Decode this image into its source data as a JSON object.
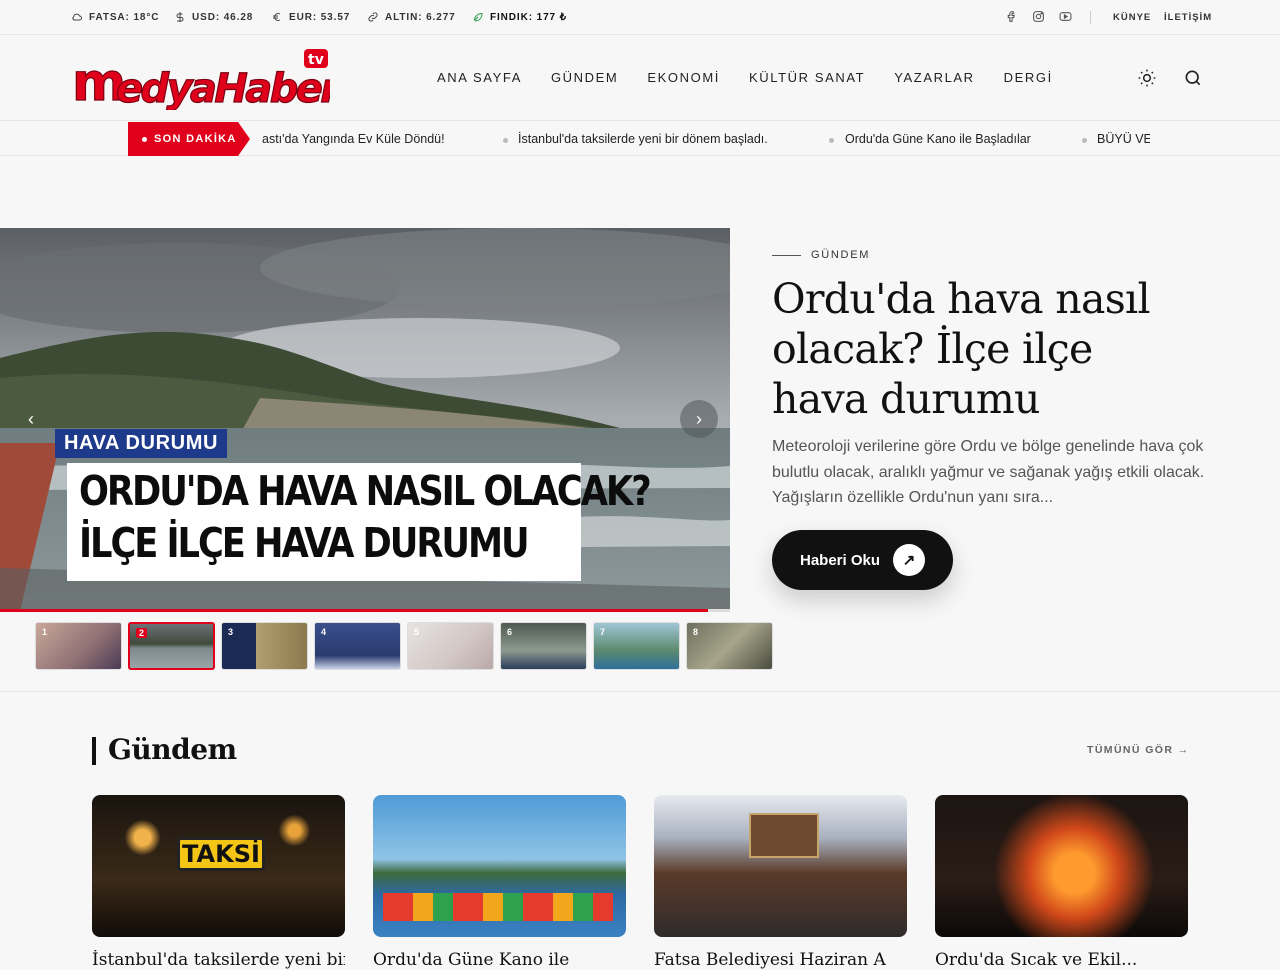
{
  "topbar": {
    "weather": "FATSA: 18°C",
    "usd": "USD: 46.28",
    "eur": "EUR: 53.57",
    "gold": "ALTIN: 6.277",
    "hazelnut": "FINDIK: 177 ₺",
    "links": [
      "KÜNYE",
      "İLETİŞİM"
    ],
    "social_icons": [
      "facebook-icon",
      "instagram-icon",
      "youtube-icon"
    ]
  },
  "header": {
    "logo_text": "medyaHaber",
    "logo_badge": "tv",
    "nav": [
      "ANA SAYFA",
      "GÜNDEM",
      "EKONOMİ",
      "KÜLTÜR SANAT",
      "YAZARLAR",
      "DERGİ"
    ]
  },
  "breaking": {
    "label": "SON DAKİKA",
    "items": [
      "Kabadüz'de Baskı: Aşırı Sıcaklar ve Korkutan Anlar – Yabastı'da Yangında Ev Küle Döndü!",
      "İstanbul'da taksilerde yeni bir dönem başladı.",
      "Ordu'da Güne Kano ile Başladılar",
      "BÜYÜ VE"
    ],
    "first_visible": "astı'da Yangında Ev Küle Döndü!"
  },
  "hero": {
    "category": "GÜNDEM",
    "title": "Ordu'da hava nasıl olacak? İlçe ilçe hava durumu",
    "description": "Meteoroloji verilerine göre Ordu ve bölge genelinde hava çok bulutlu olacak, aralıklı yağmur ve sağanak yağış etkili olacak. Yağışların özellikle Ordu'nun yanı sıra...",
    "button": "Haberi Oku",
    "image_tag": "HAVA DURUMU",
    "image_headline_1": "ORDU'DA HAVA NASIL OLACAK?",
    "image_headline_2": "İLÇE İLÇE HAVA DURUMU",
    "progress": 0.97,
    "thumbs": [
      "1",
      "2",
      "3",
      "4",
      "5",
      "6",
      "7",
      "8"
    ],
    "active_thumb": 2
  },
  "section": {
    "title": "Gündem",
    "see_all": "TÜMÜNÜ GÖR →",
    "cards": [
      {
        "title": "İstanbul'da taksilerde yeni bir"
      },
      {
        "title": "Ordu'da Güne Kano ile"
      },
      {
        "title": "Fatsa Belediyesi Haziran A"
      },
      {
        "title": "Ordu'da Sıcak ve Ekil..."
      }
    ]
  },
  "colors": {
    "accent": "#e1001b",
    "dark": "#111111",
    "tag_blue": "#1e3a8a"
  }
}
